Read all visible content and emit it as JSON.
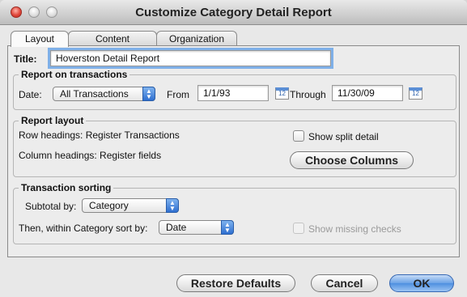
{
  "window": {
    "title": "Customize Category Detail Report"
  },
  "tabs": [
    {
      "label": "Layout",
      "active": true
    },
    {
      "label": "Content",
      "active": false
    },
    {
      "label": "Organization",
      "active": false
    }
  ],
  "title_field": {
    "label": "Title:",
    "value": "Hoverston Detail Report"
  },
  "report_on": {
    "group_label": "Report on transactions",
    "date_label": "Date:",
    "date_value": "All Transactions",
    "from_label": "From",
    "from_value": "1/1/93",
    "through_label": "Through",
    "through_value": "11/30/09",
    "calendar_glyph": "12"
  },
  "layout": {
    "group_label": "Report layout",
    "row_headings": "Row headings: Register Transactions",
    "column_headings": "Column headings: Register fields",
    "show_split_label": "Show split detail",
    "show_split_checked": false,
    "choose_columns_label": "Choose Columns"
  },
  "sorting": {
    "group_label": "Transaction sorting",
    "subtotal_label": "Subtotal by:",
    "subtotal_value": "Category",
    "then_label": "Then, within Category sort by:",
    "then_value": "Date",
    "missing_checks_label": "Show missing checks",
    "missing_checks_checked": false,
    "missing_checks_enabled": false
  },
  "buttons": {
    "restore": "Restore Defaults",
    "cancel": "Cancel",
    "ok": "OK"
  },
  "icons": {
    "popup_arrows": "▲▼"
  }
}
